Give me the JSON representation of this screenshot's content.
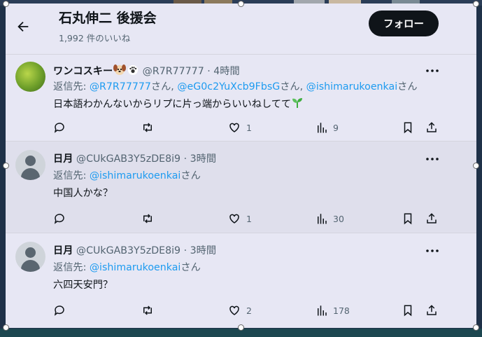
{
  "header": {
    "title": "石丸伸二 後援会",
    "subtitle": "1,992 件のいいね",
    "follow_label": "フォロー"
  },
  "tweets": [
    {
      "name": "ワンコスキー",
      "handle": "@R7R77777",
      "time": "4時間",
      "reply_prefix": "返信先:",
      "reply_mentions": [
        "@R7R77777",
        "@eG0c2YuXcb9FbsG",
        "@ishimarukoenkai"
      ],
      "reply_suffix": "さん",
      "reply_separator": "さん, ",
      "text": "日本語わかんないからリプに片っ端からいいねしてて",
      "likes": "1",
      "views": "9"
    },
    {
      "name": "日月",
      "handle": "@CUkGAB3Y5zDE8i9",
      "time": "3時間",
      "reply_prefix": "返信先:",
      "reply_mentions": [
        "@ishimarukoenkai"
      ],
      "reply_suffix": "さん",
      "text": "中国人かな？",
      "likes": "1",
      "views": "30"
    },
    {
      "name": "日月",
      "handle": "@CUkGAB3Y5zDE8i9",
      "time": "3時間",
      "reply_prefix": "返信先:",
      "reply_mentions": [
        "@ishimarukoenkai"
      ],
      "reply_suffix": "さん",
      "text": "六四天安門？",
      "likes": "2",
      "views": "178"
    }
  ],
  "icons": [
    "back-arrow-icon",
    "more-icon",
    "reply-icon",
    "retweet-icon",
    "like-icon",
    "views-icon",
    "bookmark-icon",
    "share-icon",
    "dog-emoji-icon",
    "paw-emoji-icon",
    "seedling-emoji-icon"
  ],
  "colors": {
    "background": "#e7e7f4",
    "mention": "#1d9bf0",
    "muted": "#536471",
    "follow_button": "#0f1419"
  }
}
